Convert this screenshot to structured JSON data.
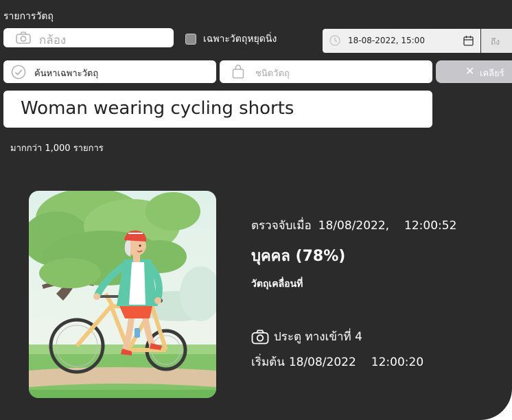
{
  "header": {
    "title": "รายการวัตถุ"
  },
  "filters": {
    "camera_value": "กล้อง",
    "stopped_only_label": "เฉพาะวัตถุหยุดนิ่ง",
    "date_from": "18-08-2022, 15:00",
    "date_to_label": "ถึง",
    "search_value": "ค้นหาเฉพาะวัตถุ",
    "object_type_placeholder": "ชนิดวัตถุ",
    "clear_label": "เคลียร์",
    "clear_icon": "close-icon"
  },
  "query": {
    "value": "Woman wearing cycling shorts"
  },
  "results": {
    "count_text": "มากกว่า 1,000 รายการ"
  },
  "detail": {
    "detected_label": "ตรวจจับเมื่อ",
    "detected_date": "18/08/2022,",
    "detected_time": "12:00:52",
    "object_class": "บุคคล (78%)",
    "motion": "วัตถุเคลื่อนที่",
    "camera_name": "ประตู ทางเข้าที่ 4",
    "start_label": "เริ่มต้น",
    "start_date": "18/08/2022",
    "start_time": "12:00:20"
  }
}
